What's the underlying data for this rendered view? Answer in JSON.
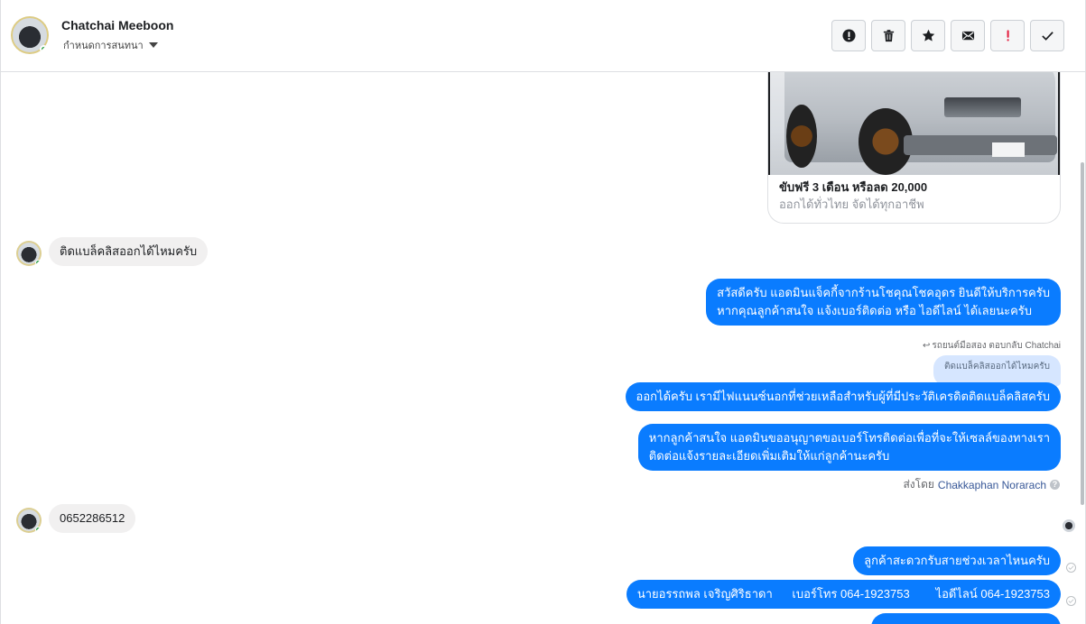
{
  "header": {
    "contact_name": "Chatchai Meeboon",
    "stage_label": "กำหนดการสนทนา",
    "toolbar": [
      {
        "name": "report-spam-button",
        "icon": "alert-circle-icon"
      },
      {
        "name": "delete-button",
        "icon": "trash-icon"
      },
      {
        "name": "star-button",
        "icon": "star-icon"
      },
      {
        "name": "mark-unread-button",
        "icon": "envelope-icon"
      },
      {
        "name": "follow-up-button",
        "icon": "exclamation-icon"
      },
      {
        "name": "mark-done-button",
        "icon": "check-icon"
      }
    ]
  },
  "ad_card": {
    "title": "ขับฟรี 3 เดือน หรือลด 20,000",
    "subtitle": "ออกได้ทั่วไทย จัดได้ทุกอาชีพ"
  },
  "messages": {
    "in_1": "ติดแบล็คลิสออกได้ไหมครับ",
    "out_1_line1": "สวัสดีครับ แอดมินแจ็คกี้จากร้านโชคุณโชคอุดร ยินดีให้บริการครับ",
    "out_1_line2": "หากคุณลูกค้าสนใจ แจ้งเบอร์ติดต่อ หรือ ไอดีไลน์ ได้เลยนะครับ",
    "reply_meta": "รถยนต์มือสอง ตอบกลับ Chatchai",
    "quoted": "ติดแบล็คลิสออกได้ไหมครับ",
    "out_2": "ออกได้ครับ เรามีไฟแนนซ์นอกที่ช่วยเหลือสำหรับผู้ที่มีประวัติเครดิตติดแบล็คลิสครับ",
    "out_3_line1": "หากลูกค้าสนใจ แอดมินขออนุญาตขอเบอร์โทรติดต่อเพื่อที่จะให้เซลล์ของทางเรา",
    "out_3_line2": "ติดต่อแจ้งรายละเอียดเพิ่มเติมให้แก่ลูกค้านะครับ",
    "sent_by_prefix": "ส่งโดย",
    "sent_by_agent": "Chakkaphan Norarach",
    "in_2": "0652286512",
    "out_4": "ลูกค้าสะดวกรับสายช่วงเวลาไหนครับ",
    "out_5": "นายอรรถพล เจริญศิริธาดา      เบอร์โทร 064-1923753        ไอดีไลน์ 064-1923753"
  },
  "colors": {
    "outgoing_bubble": "#0a7cff",
    "incoming_bubble": "#f1f0f0",
    "quoted_bubble": "#d6e6ff",
    "online_dot": "#31a24c",
    "follow_up_red": "#e41e3f"
  }
}
